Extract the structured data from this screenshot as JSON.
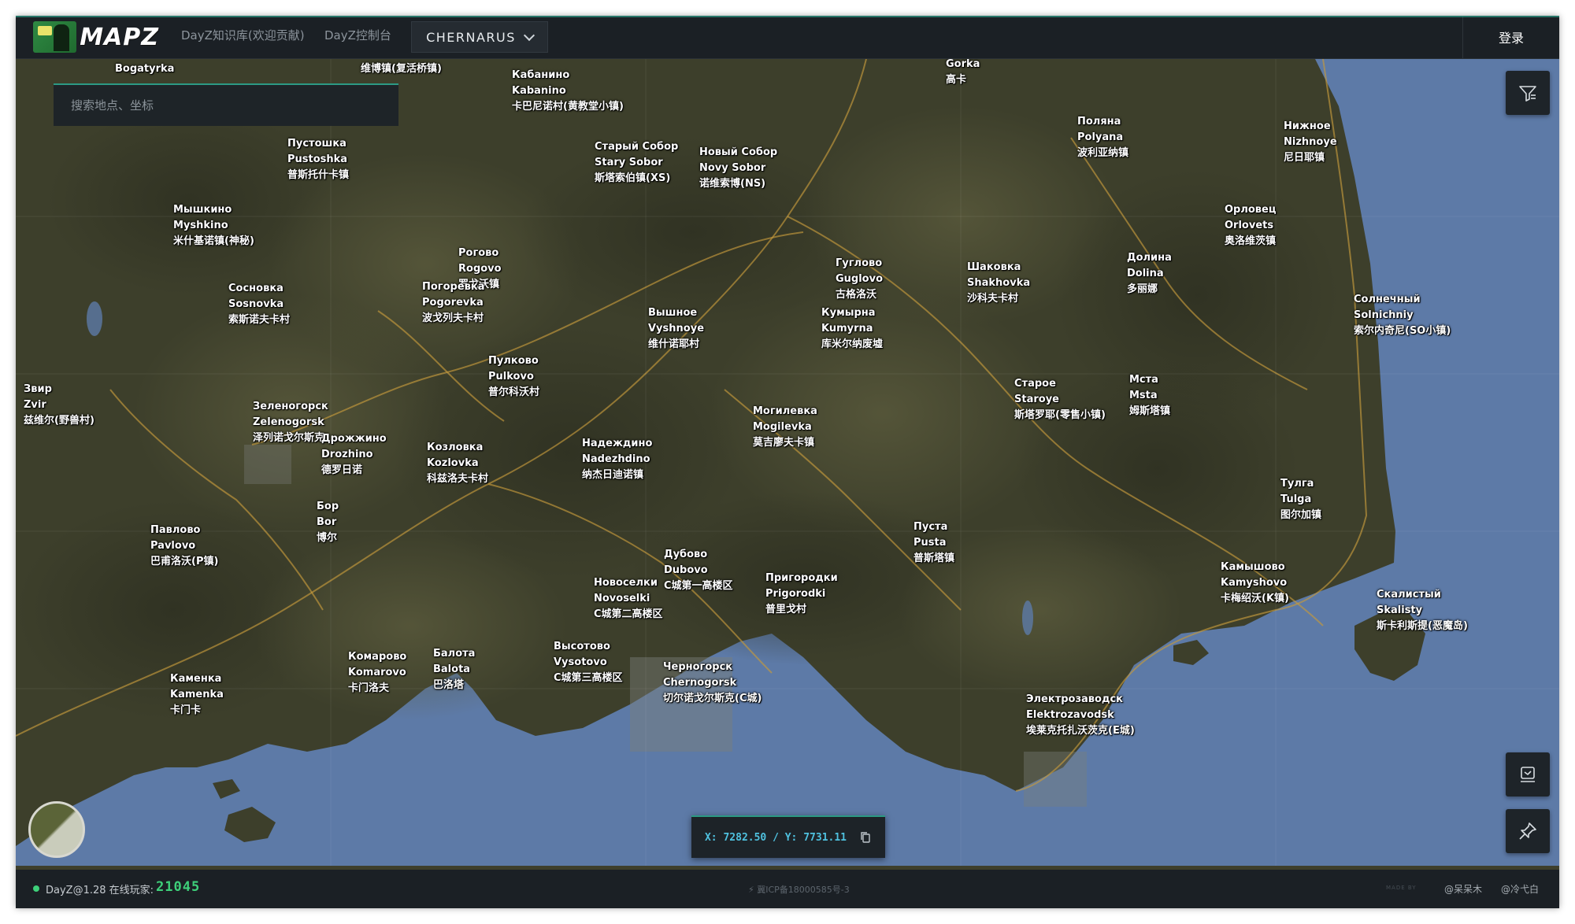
{
  "header": {
    "logo_text": "MAPZ",
    "nav": [
      "DayZ知识库(欢迎贡献)",
      "DayZ控制台"
    ],
    "map_select": "CHERNARUS",
    "login": "登录"
  },
  "search": {
    "placeholder": "搜索地点、坐标"
  },
  "coords": {
    "text": "X: 7282.50 / Y: 7731.11"
  },
  "footer": {
    "version": "DayZ@1.28 在线玩家:",
    "online_count": "21045",
    "icp": "⚡ 冀ICP备18000585号-3",
    "made_by": "MADE BY",
    "credits": [
      "@呆呆木",
      "@冷弋白"
    ]
  },
  "icons": {
    "filter": "filter-icon",
    "layers": "map-layers-icon",
    "pin": "pin-icon",
    "copy": "copy-icon"
  },
  "colors": {
    "accent": "#2c9a84",
    "online": "#3ed07a",
    "coords": "#4fc1df",
    "sea": "#5d7aa7",
    "land": "#3e3f2c"
  },
  "places": [
    {
      "lines": [
        "Bogatyrka"
      ]
    },
    {
      "lines": [
        "维博镇(复活桥镇)"
      ]
    },
    {
      "lines": [
        "Кабанино",
        "Kabanino",
        "卡巴尼诺村(黄教堂小镇)"
      ]
    },
    {
      "lines": [
        "Gorka",
        "高卡"
      ]
    },
    {
      "lines": [
        "Пустошка",
        "Pustoshka",
        "普斯托什卡镇"
      ]
    },
    {
      "lines": [
        "Старый Собор",
        "Stary Sobor",
        "斯塔索伯镇(XS)"
      ]
    },
    {
      "lines": [
        "Новый Собор",
        "Novy Sobor",
        "诺维索博(NS)"
      ]
    },
    {
      "lines": [
        "Поляна",
        "Polyana",
        "波利亚纳镇"
      ]
    },
    {
      "lines": [
        "Нижное",
        "Nizhnoye",
        "尼日耶镇"
      ]
    },
    {
      "lines": [
        "Мышкино",
        "Myshkino",
        "米什基诺镇(神秘)"
      ]
    },
    {
      "lines": [
        "Орловец",
        "Orlovets",
        "奥洛维茨镇"
      ]
    },
    {
      "lines": [
        "Рогово",
        "Rogovo",
        "罗戈沃镇"
      ]
    },
    {
      "lines": [
        "Погоревка",
        "Pogorevka",
        "波戈列夫卡村"
      ]
    },
    {
      "lines": [
        "Сосновка",
        "Sosnovka",
        "索斯诺夫卡村"
      ]
    },
    {
      "lines": [
        "Гуглово",
        "Guglovo",
        "古格洛沃"
      ]
    },
    {
      "lines": [
        "Шаковка",
        "Shakhovka",
        "沙科夫卡村"
      ]
    },
    {
      "lines": [
        "Долина",
        "Dolina",
        "多丽娜"
      ]
    },
    {
      "lines": [
        "Солнечный",
        "Solnichniy",
        "索尔内奇尼(SO小镇)"
      ]
    },
    {
      "lines": [
        "Вышное",
        "Vyshnoye",
        "维什诺耶村"
      ]
    },
    {
      "lines": [
        "Кумырна",
        "Kumyrna",
        "库米尔纳废墟"
      ]
    },
    {
      "lines": [
        "Пулково",
        "Pulkovo",
        "普尔科沃村"
      ]
    },
    {
      "lines": [
        "Звир",
        "Zvir",
        "兹维尔(野兽村)"
      ]
    },
    {
      "lines": [
        "Зеленогорск",
        "Zelenogorsk",
        "泽列诺戈尔斯克"
      ]
    },
    {
      "lines": [
        "Дрожжино",
        "Drozhino",
        "德罗日诺"
      ]
    },
    {
      "lines": [
        "Старое",
        "Staroye",
        "斯塔罗耶(零售小镇)"
      ]
    },
    {
      "lines": [
        "Мста",
        "Msta",
        "姆斯塔镇"
      ]
    },
    {
      "lines": [
        "Могилевка",
        "Mogilevka",
        "莫吉廖夫卡镇"
      ]
    },
    {
      "lines": [
        "Козловка",
        "Kozlovka",
        "科兹洛夫卡村"
      ]
    },
    {
      "lines": [
        "Надеждино",
        "Nadezhdino",
        "纳杰日迪诺镇"
      ]
    },
    {
      "lines": [
        "Тулга",
        "Tulga",
        "图尔加镇"
      ]
    },
    {
      "lines": [
        "Бор",
        "Bor",
        "博尔"
      ]
    },
    {
      "lines": [
        "Павлово",
        "Pavlovo",
        "巴甫洛沃(P镇)"
      ]
    },
    {
      "lines": [
        "Пуста",
        "Pusta",
        "普斯塔镇"
      ]
    },
    {
      "lines": [
        "Дубово",
        "Dubovo",
        "C城第一高楼区"
      ]
    },
    {
      "lines": [
        "Камышово",
        "Kamyshovo",
        "卡梅绍沃(K镇)"
      ]
    },
    {
      "lines": [
        "Пригородки",
        "Prigorodki",
        "普里戈村"
      ]
    },
    {
      "lines": [
        "Новоселки",
        "Novoselki",
        "C城第二高楼区"
      ]
    },
    {
      "lines": [
        "Скалистый",
        "Skalisty",
        "斯卡利斯提(恶魔岛)"
      ]
    },
    {
      "lines": [
        "Высотово",
        "Vysotovo",
        "C城第三高楼区"
      ]
    },
    {
      "lines": [
        "Комарово",
        "Komarovo",
        "卡门洛夫"
      ]
    },
    {
      "lines": [
        "Балота",
        "Balota",
        "巴洛塔"
      ]
    },
    {
      "lines": [
        "Черногорск",
        "Chernogorsk",
        "切尔诺戈尔斯克(C城)"
      ]
    },
    {
      "lines": [
        "Каменка",
        "Kamenka",
        "卡门卡"
      ]
    },
    {
      "lines": [
        "Электрозаводск",
        "Elektrozavodsk",
        "埃莱克托扎沃茨克(E城)"
      ]
    }
  ]
}
